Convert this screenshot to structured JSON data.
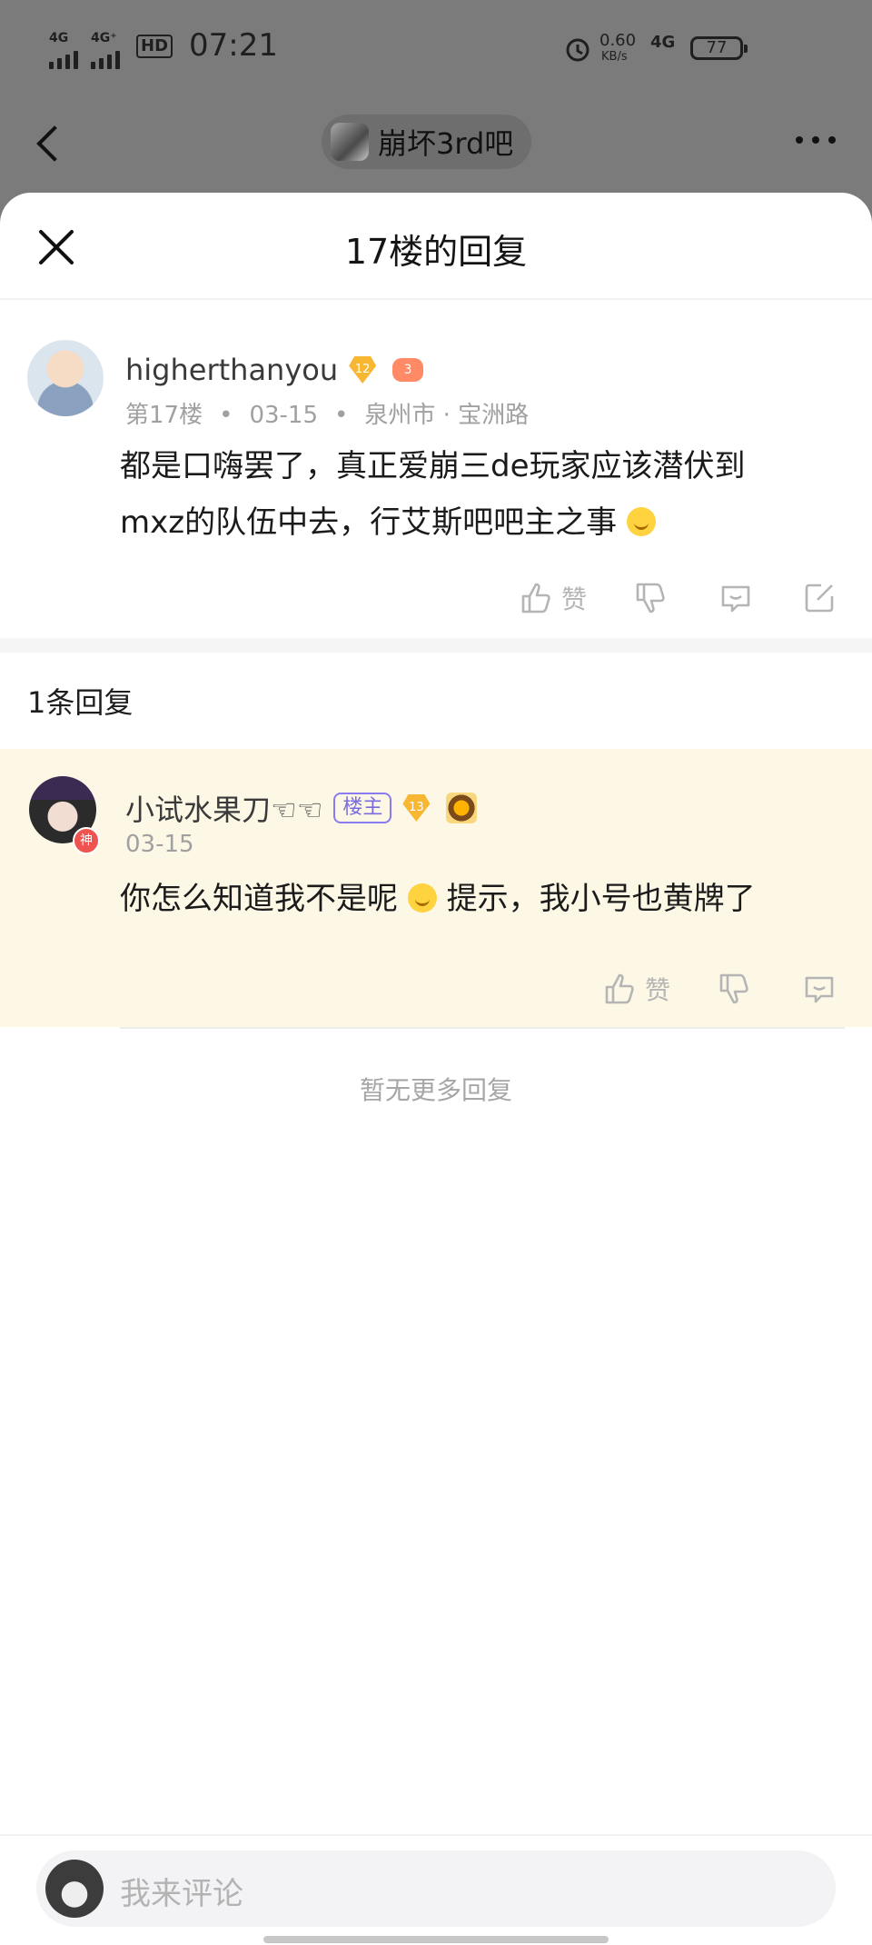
{
  "status_bar": {
    "network_1": "4G",
    "network_2": "4G⁺",
    "hd": "HD",
    "time": "07:21",
    "speed": "0.60",
    "speed_unit": "KB/s",
    "network_right": "4G",
    "battery": "77"
  },
  "nav": {
    "forum_name": "崩坏3rd吧"
  },
  "sheet": {
    "title": "17楼的回复"
  },
  "post": {
    "username": "higherthanyou",
    "level": "12",
    "game_badge": "3",
    "floor": "第17楼",
    "date": "03-15",
    "location": "泉州市 · 宝洲路",
    "content_line1": "都是口嗨罢了，真正爱崩三de玩家应该潜伏到",
    "content_line2": "mxz的队伍中去，行艾斯吧吧主之事",
    "like_label": "赞"
  },
  "replies": {
    "count_label": "1条回复",
    "items": [
      {
        "username": "小试水果刀☜☜",
        "owner_badge": "楼主",
        "level": "13",
        "god_badge": "神",
        "date": "03-15",
        "content_before": "你怎么知道我不是呢",
        "content_after": "提示，我小号也黄牌了",
        "like_label": "赞"
      }
    ],
    "no_more": "暂无更多回复"
  },
  "comment_bar": {
    "placeholder": "我来评论"
  },
  "colors": {
    "dim_overlay": "#7b7b7b",
    "highlight_reply_bg": "#fdf8e6",
    "owner_badge": "#7a6be0",
    "level_badge": "#f7b733"
  },
  "icons": [
    "back-arrow-icon",
    "more-icon",
    "close-icon",
    "thumbs-up-icon",
    "thumbs-down-icon",
    "comment-icon",
    "share-icon"
  ]
}
